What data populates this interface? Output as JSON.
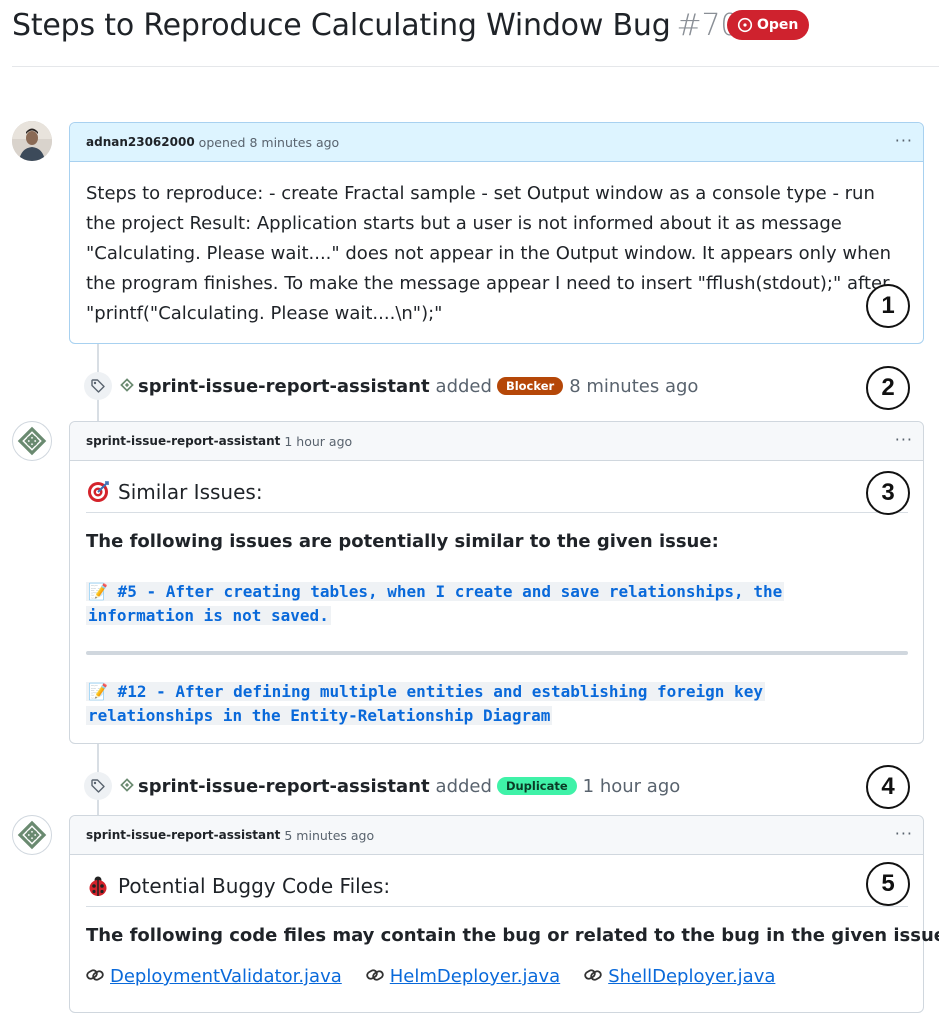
{
  "issue": {
    "title": "Steps to Reproduce Calculating Window Bug",
    "number": "#70",
    "state": "Open"
  },
  "comment1": {
    "author": "adnan23062000",
    "meta": "opened 8 minutes ago",
    "body": "Steps to reproduce: - create Fractal sample - set Output window as a console type - run the project Result: Application starts but a user is not informed about it as message \"Calculating. Please wait....\" does not appear in the Output window. It appears only when the program finishes. To make the message appear I need to insert \"fflush(stdout);\" after \"printf(\"Calculating. Please wait....\\n\");\""
  },
  "event1": {
    "actor": "sprint-issue-report-assistant",
    "action": "added",
    "label": "Blocker",
    "time": "8 minutes ago"
  },
  "comment2": {
    "author": "sprint-issue-report-assistant",
    "meta": "1 hour ago",
    "heading": "Similar Issues:",
    "intro": "The following issues are potentially similar to the given issue:",
    "issues": [
      "📝  #5 - After creating tables, when I create and save relationships, the information is not saved.",
      "📝  #12 - After defining multiple entities and establishing foreign key relationships in the Entity-Relationship Diagram"
    ]
  },
  "event2": {
    "actor": "sprint-issue-report-assistant",
    "action": "added",
    "label": "Duplicate",
    "time": "1 hour ago"
  },
  "comment3": {
    "author": "sprint-issue-report-assistant",
    "meta": "5 minutes ago",
    "heading": "Potential Buggy Code Files:",
    "intro": "The following code files may contain the bug or related to the bug in the given issue:",
    "files": [
      "DeploymentValidator.java",
      "HelmDeployer.java",
      "ShellDeployer.java"
    ]
  },
  "markers": [
    "1",
    "2",
    "3",
    "4",
    "5"
  ],
  "icons": {
    "state": "issue-open-icon",
    "kebab": "kebab-menu-icon",
    "tag": "tag-icon",
    "bot_logo": "bot-logo-icon",
    "target": "direct-hit-emoji",
    "bug": "lady-beetle-emoji",
    "clip": "link-icon"
  },
  "colors": {
    "open": "#cf222e",
    "blocker": "#b54708",
    "duplicate": "#3ff2a8",
    "link": "#0969da",
    "author_header_bg": "#ddf4ff"
  }
}
